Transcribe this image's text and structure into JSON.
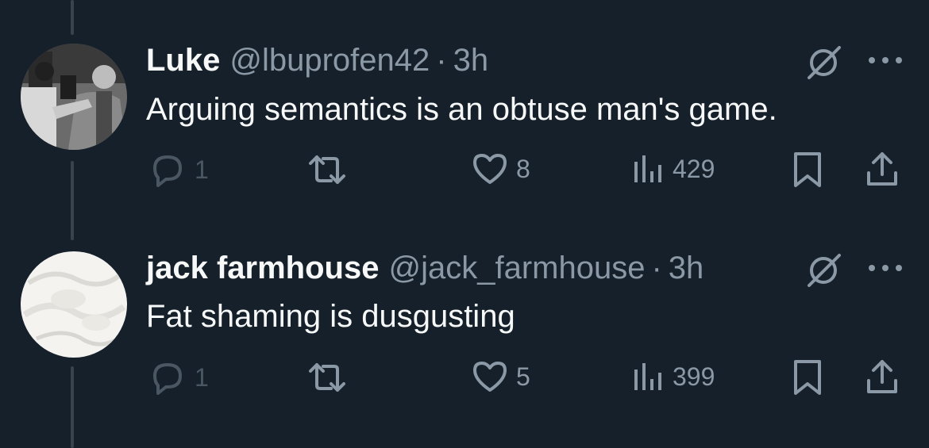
{
  "tweets": [
    {
      "name": "Luke",
      "handle": "@lbuprofen42",
      "separator": "·",
      "time": "3h",
      "text": "Arguing semantics is an obtuse man's game.",
      "replies": "1",
      "likes": "8",
      "views": "429",
      "avatar": "photo-grayscale-crowd"
    },
    {
      "name": "jack farmhouse",
      "handle": "@jack_farmhouse",
      "separator": "·",
      "time": "3h",
      "text": "Fat shaming is dusgusting",
      "replies": "1",
      "likes": "5",
      "views": "399",
      "avatar": "photo-white-fabric"
    }
  ],
  "icons": {
    "reply": "reply-icon",
    "retweet": "retweet-icon",
    "like": "heart-icon",
    "views": "views-icon",
    "bookmark": "bookmark-icon",
    "share": "share-icon",
    "grok": "grok-icon",
    "more": "more-icon"
  },
  "colors": {
    "background": "#15202b",
    "primary_text": "#f7f9f9",
    "secondary_text": "#8b98a5",
    "thread_line": "#38444d"
  }
}
